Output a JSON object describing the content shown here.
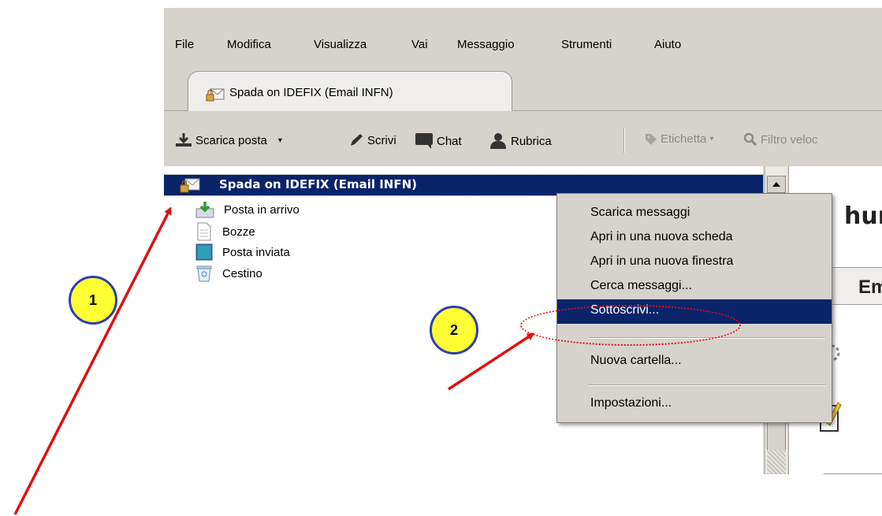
{
  "menubar": {
    "items": [
      "File",
      "Modifica",
      "Visualizza",
      "Vai",
      "Messaggio",
      "Strumenti",
      "Aiuto"
    ]
  },
  "tab": {
    "title": "Spada on IDEFIX (Email INFN)"
  },
  "toolbar": {
    "scarica": "Scarica posta",
    "scrivi": "Scrivi",
    "chat": "Chat",
    "rubrica": "Rubrica",
    "etichetta": "Etichetta",
    "filtro": "Filtro veloc"
  },
  "folders": {
    "account": "Spada on IDEFIX (Email INFN)",
    "items": [
      "Posta in arrivo",
      "Bozze",
      "Posta inviata",
      "Cestino"
    ]
  },
  "content": {
    "title": "hur",
    "subtitle": "Em"
  },
  "context_menu": {
    "items": [
      "Scarica messaggi",
      "Apri in una nuova scheda",
      "Apri in una nuova finestra",
      "Cerca messaggi...",
      "Sottoscrivi...",
      "Nuova cartella...",
      "Impostazioni..."
    ],
    "highlighted": "Sottoscrivi..."
  },
  "annotations": {
    "badge1": "1",
    "badge2": "2",
    "color_arrow": "#e01010",
    "color_badge": "#ffff33"
  },
  "colors": {
    "selection": "#0a246a",
    "chrome": "#d6d3ce"
  }
}
